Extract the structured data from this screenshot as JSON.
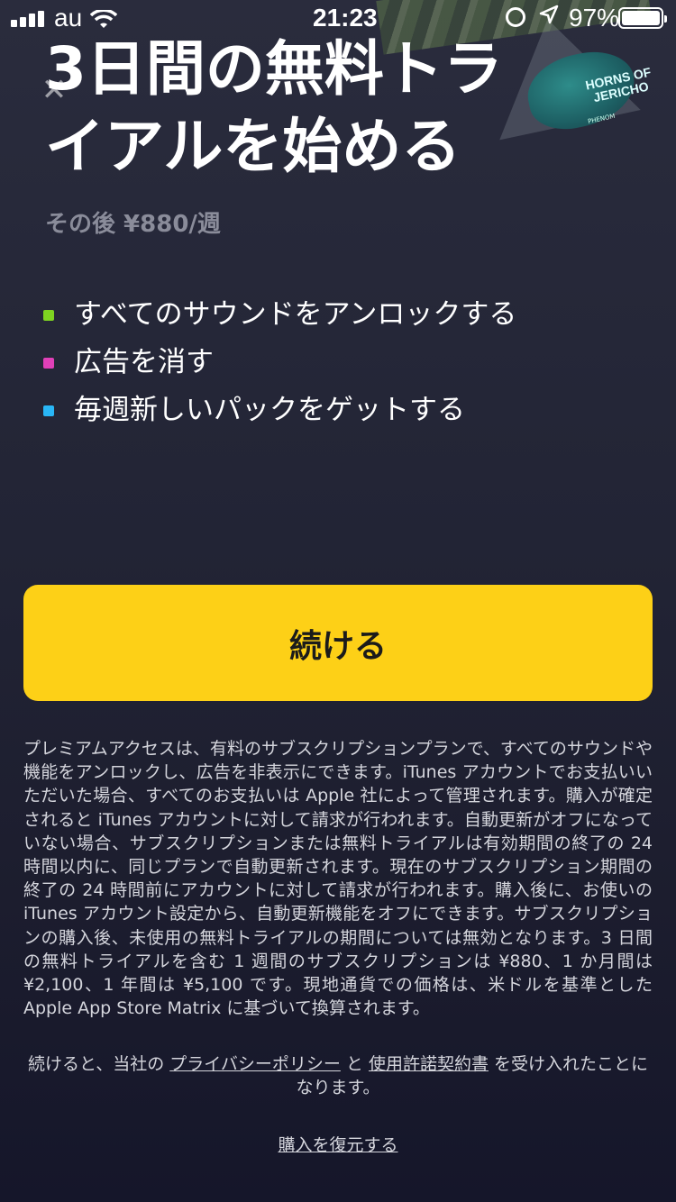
{
  "status_bar": {
    "carrier": "au",
    "time": "21:23",
    "battery_percent": "97%",
    "wifi_icon": "wifi-icon",
    "location_icon": "location-arrow-icon",
    "rotation_lock_icon": "rotation-lock-icon"
  },
  "album_art": {
    "title": "HORNS OF JERICHO",
    "subtitle": "PHENOM"
  },
  "close_button": {
    "icon": "close-icon",
    "glyph": "✕"
  },
  "headline": "3日間の無料トライアルを始める",
  "price_note": "その後 ¥880/週",
  "features": [
    {
      "label": "すべてのサウンドをアンロックする",
      "color": "#7ed321"
    },
    {
      "label": "広告を消す",
      "color": "#e040b8"
    },
    {
      "label": "毎週新しいパックをゲットする",
      "color": "#29b6f6"
    }
  ],
  "cta": {
    "label": "続ける",
    "color": "#fdd017"
  },
  "legal_text": "プレミアムアクセスは、有料のサブスクリプションプランで、すべてのサウンドや機能をアンロックし、広告を非表示にできます。iTunes アカウントでお支払いいただいた場合、すべてのお支払いは Apple 社によって管理されます。購入が確定されると iTunes アカウントに対して請求が行われます。自動更新がオフになっていない場合、サブスクリプションまたは無料トライアルは有効期間の終了の 24 時間以内に、同じプランで自動更新されます。現在のサブスクリプション期間の終了の 24 時間前にアカウントに対して請求が行われます。購入後に、お使いの iTunes アカウント設定から、自動更新機能をオフにできます。サブスクリプションの購入後、未使用の無料トライアルの期間については無効となります。3 日間の無料トライアルを含む 1 週間のサブスクリプションは ¥880、1 か月間は ¥2,100、1 年間は ¥5,100 です。現地通貨での価格は、米ドルを基準とした Apple App Store Matrix に基づいて換算されます。",
  "agreement": {
    "prefix": "続けると、当社の ",
    "privacy_link": "プライバシーポリシー",
    "middle": " と ",
    "terms_link": "使用許諾契約書",
    "suffix": " を受け入れたことになります。"
  },
  "restore_link": "購入を復元する"
}
